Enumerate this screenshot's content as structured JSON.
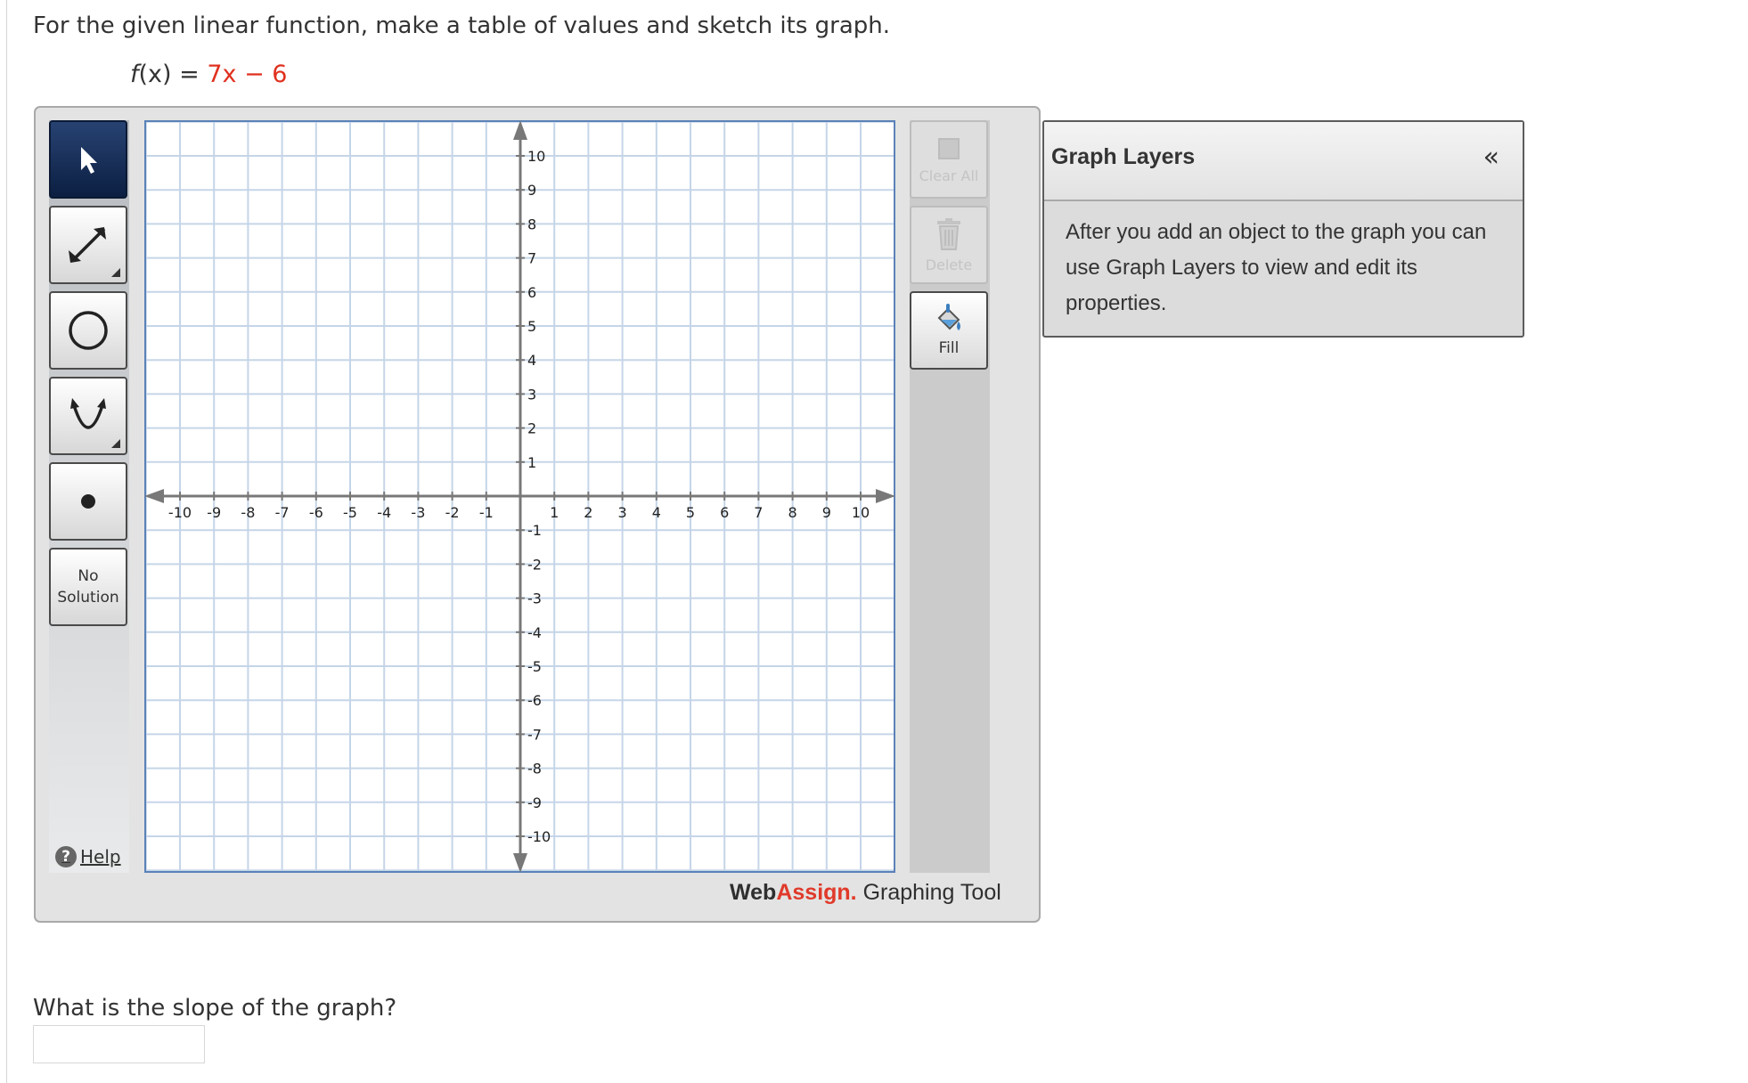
{
  "problem": {
    "prompt": "For the given linear function, make a table of values and sketch its graph.",
    "function_lhs": "f",
    "function_arg": "(x) = ",
    "function_term": "7x − 6"
  },
  "tools": {
    "no_solution_line1": "No",
    "no_solution_line2": "Solution",
    "help_label": "Help"
  },
  "actions": {
    "clear_all": "Clear All",
    "delete": "Delete",
    "fill": "Fill"
  },
  "graph": {
    "x_range": [
      -10,
      10
    ],
    "y_range": [
      -10,
      10
    ],
    "x_ticks": [
      "-10",
      "-9",
      "-8",
      "-7",
      "-6",
      "-5",
      "-4",
      "-3",
      "-2",
      "-1",
      "1",
      "2",
      "3",
      "4",
      "5",
      "6",
      "7",
      "8",
      "9",
      "10"
    ],
    "y_ticks": [
      "10",
      "9",
      "8",
      "7",
      "6",
      "5",
      "4",
      "3",
      "2",
      "1",
      "-1",
      "-2",
      "-3",
      "-4",
      "-5",
      "-6",
      "-7",
      "-8",
      "-9",
      "-10"
    ],
    "grid": true
  },
  "branding": {
    "web": "Web",
    "assign": "Assign.",
    "tool": " Graphing Tool",
    "web_color": "#2f2f2f",
    "assign_color": "#e03a2a"
  },
  "layers": {
    "title": "Graph Layers",
    "collapse_symbol": "«",
    "description": "After you add an object to the graph you can use Graph Layers to view and edit its properties."
  },
  "question": {
    "text": "What is the slope of the graph?",
    "answer_value": ""
  },
  "colors": {
    "grid_line": "#c5d5e8",
    "axis": "#787878",
    "frame_accent": "#5b82b8",
    "active_tool": "#1b3060",
    "function_accent": "#e0301e"
  }
}
